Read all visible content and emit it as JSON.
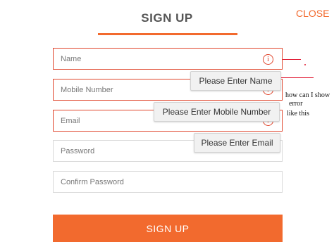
{
  "header": {
    "title": "SIGN UP",
    "close_label": "CLOSE"
  },
  "form": {
    "name_placeholder": "Name",
    "mobile_placeholder": "Mobile Number",
    "email_placeholder": "Email",
    "password_placeholder": "Password",
    "confirm_password_placeholder": "Confirm Password",
    "submit_label": "SIGN UP"
  },
  "errors": {
    "icon_glyph": "i",
    "name": "Please Enter Name",
    "mobile": "Please Enter Mobile Number",
    "email": "Please Enter Email"
  },
  "annotation": {
    "line1": "how can I show",
    "line2": "error",
    "line3": "like this",
    "color": "#e0102a"
  },
  "colors": {
    "accent": "#f26a2e",
    "error": "#e0452c"
  }
}
